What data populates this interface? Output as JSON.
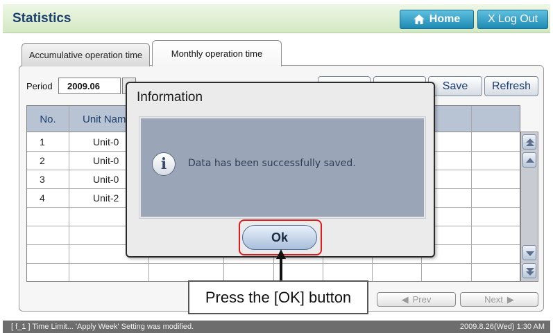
{
  "header": {
    "title": "Statistics",
    "home_label": "Home",
    "logout_label": "X Log Out"
  },
  "tabs": [
    {
      "label": "Accumulative operation time",
      "active": false
    },
    {
      "label": "Monthly operation time",
      "active": true
    }
  ],
  "toolbar": {
    "period_label": "Period",
    "period_value": "2009.06",
    "save_label": "Save",
    "refresh_label": "Refresh"
  },
  "table": {
    "columns": [
      "No.",
      "Unit Nam"
    ],
    "rows": [
      {
        "no": "1",
        "unit": "Unit-0"
      },
      {
        "no": "2",
        "unit": "Unit-0"
      },
      {
        "no": "3",
        "unit": "Unit-0"
      },
      {
        "no": "4",
        "unit": "Unit-2"
      }
    ]
  },
  "pagination": {
    "prev_label": "Prev",
    "next_label": "Next"
  },
  "status_bar": {
    "message": "[ f_1 ] Time Limit... 'Apply Week' Setting was modified.",
    "datetime": "2009.8.26(Wed)  1:30 AM"
  },
  "dialog": {
    "title": "Information",
    "message": "Data has been successfully saved.",
    "ok_label": "Ok",
    "icon": "info-icon"
  },
  "callout": {
    "text": "Press the [OK] button"
  },
  "colors": {
    "header_bg": "#d3e8c2",
    "accent_button": "#1d8ab3",
    "highlight": "#e01b1b",
    "dialog_body": "#9aa6b8"
  }
}
